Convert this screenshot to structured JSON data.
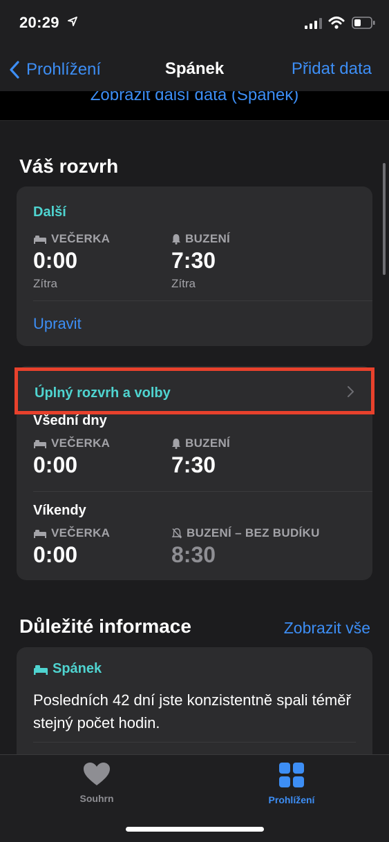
{
  "status": {
    "time": "20:29"
  },
  "nav": {
    "back_label": "Prohlížení",
    "title": "Spánek",
    "action_label": "Přidat data"
  },
  "peek_link": "Zobrazit další data (Spánek)",
  "schedule": {
    "title": "Váš rozvrh",
    "next_card": {
      "label": "Další",
      "bedtime_caption": "VEČERKA",
      "bedtime_time": "0:00",
      "bedtime_day": "Zítra",
      "wake_caption": "BUZENÍ",
      "wake_time": "7:30",
      "wake_day": "Zítra",
      "edit_label": "Upravit"
    },
    "full_schedule_label": "Úplný rozvrh a volby",
    "weekdays": {
      "title": "Všední dny",
      "bedtime_caption": "VEČERKA",
      "bedtime_time": "0:00",
      "wake_caption": "BUZENÍ",
      "wake_time": "7:30"
    },
    "weekends": {
      "title": "Víkendy",
      "bedtime_caption": "VEČERKA",
      "bedtime_time": "0:00",
      "wake_caption": "BUZENÍ – BEZ BUDÍKU",
      "wake_time": "8:30"
    }
  },
  "highlights": {
    "title": "Důležité informace",
    "see_all_label": "Zobrazit vše",
    "card": {
      "category": "Spánek",
      "text": "Posledních 42 dní jste konzistentně spali téměř stejný počet hodin."
    }
  },
  "tabs": [
    {
      "label": "Souhrn",
      "icon": "heart-icon",
      "active": false
    },
    {
      "label": "Prohlížení",
      "icon": "grid-icon",
      "active": true
    }
  ],
  "colors": {
    "accent": "#3d8ef5",
    "teal": "#4fd4d0",
    "highlight_border": "#e8412c"
  }
}
